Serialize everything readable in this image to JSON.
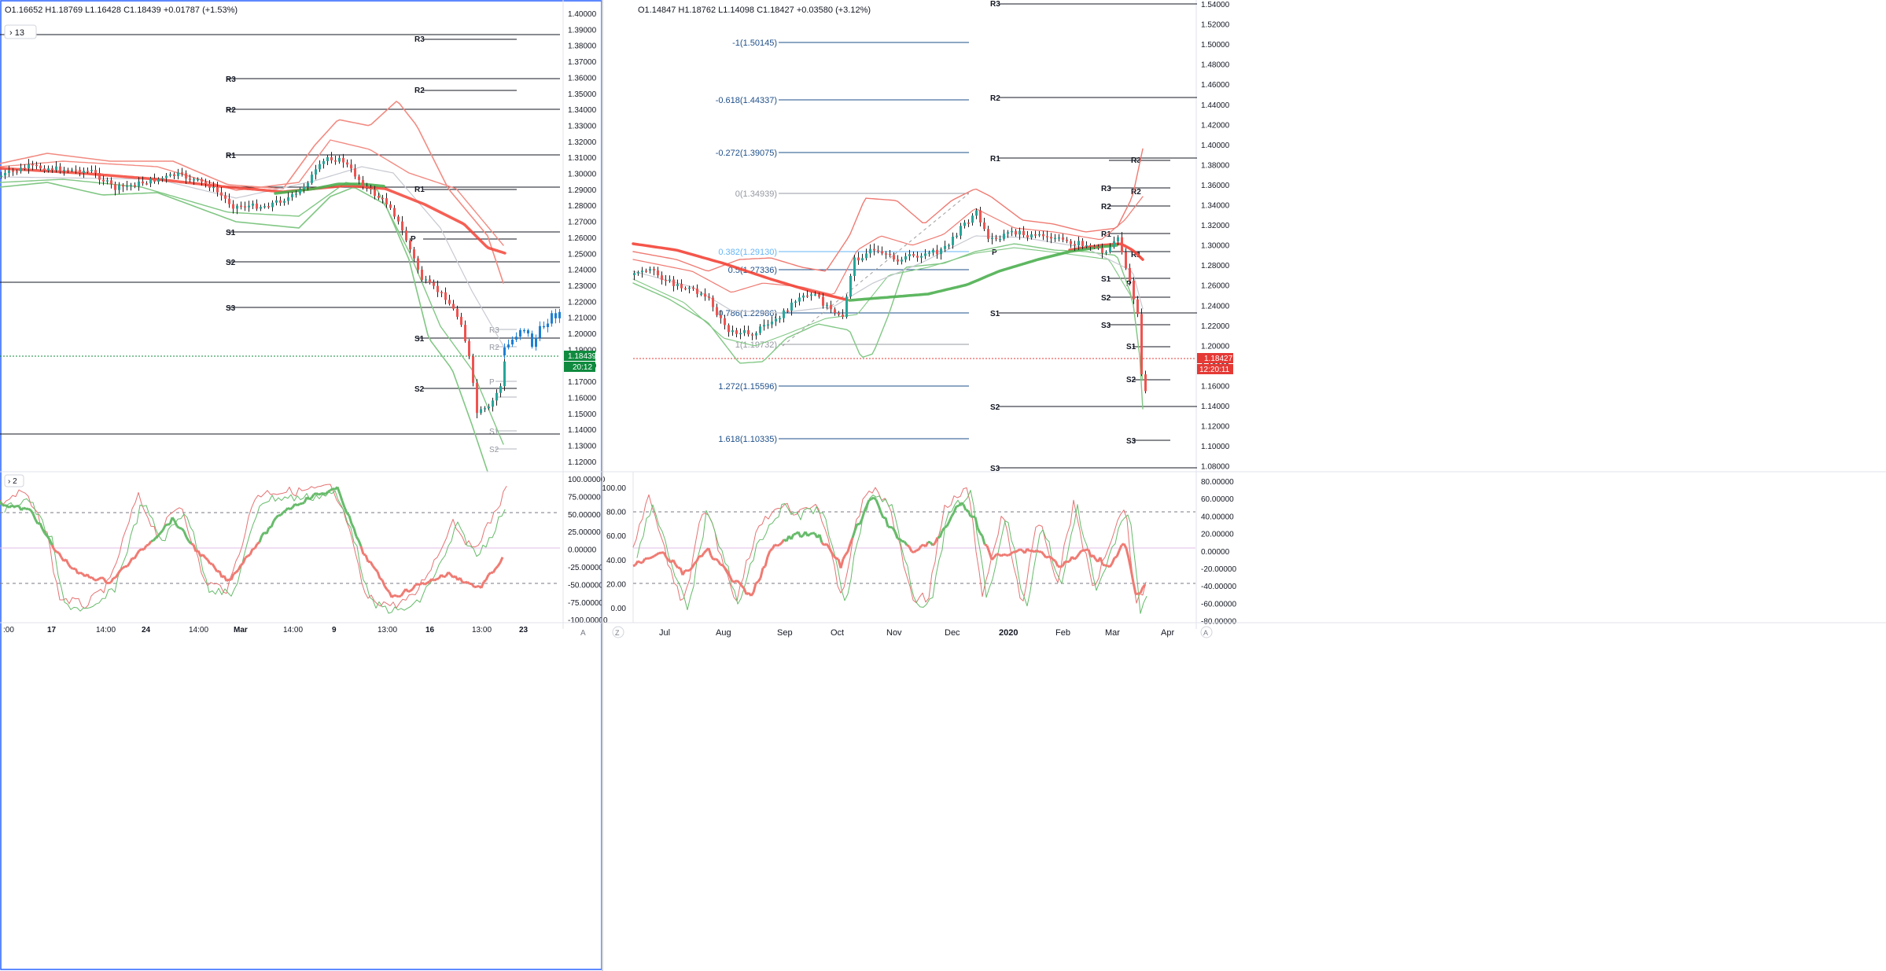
{
  "left_chart": {
    "ohlc": {
      "open": "O1.16652",
      "high": "H1.18769",
      "low": "L1.16428",
      "close": "C1.18439",
      "change": "+0.01787 (+1.53%)"
    },
    "toggle_label": "13",
    "price_axis": [
      "1.40000",
      "1.39000",
      "1.38000",
      "1.37000",
      "1.36000",
      "1.35000",
      "1.34000",
      "1.33000",
      "1.32000",
      "1.31000",
      "1.30000",
      "1.29000",
      "1.28000",
      "1.27000",
      "1.26000",
      "1.25000",
      "1.24000",
      "1.23000",
      "1.22000",
      "1.21000",
      "1.20000",
      "1.19000",
      "1.18000",
      "1.17000",
      "1.16000",
      "1.15000",
      "1.14000",
      "1.13000",
      "1.12000"
    ],
    "last_price": "1.18439",
    "countdown": "20:12",
    "pivot_labels": [
      "R3",
      "R3",
      "R2",
      "R2",
      "R1",
      "R1",
      "P",
      "S1",
      "S2",
      "S3",
      "S1",
      "S2",
      "R3",
      "R2",
      "P",
      "S1",
      "S2"
    ],
    "time_axis": [
      ":00",
      "17",
      "14:00",
      "24",
      "14:00",
      "Mar",
      "14:00",
      "9",
      "13:00",
      "16",
      "13:00",
      "23"
    ],
    "scale_button": "A"
  },
  "left_oscillator": {
    "toggle_label": "2",
    "axis": [
      "100.00000",
      "75.00000",
      "50.00000",
      "25.00000",
      "0.00000",
      "-25.00000",
      "-50.00000",
      "-75.00000",
      "-100.00000"
    ]
  },
  "right_chart": {
    "ohlc": {
      "open": "O1.14847",
      "high": "H1.18762",
      "low": "L1.14098",
      "close": "C1.18427",
      "change": "+0.03580 (+3.12%)"
    },
    "fib_levels": [
      "-1(1.50145)",
      "-0.618(1.44337)",
      "-0.272(1.39075)",
      "0(1.34939)",
      "0.382(1.29130)",
      "0.5(1.27336)",
      "0.786(1.22986)",
      "1(1.19732)",
      "1.272(1.15596)",
      "1.618(1.10335)"
    ],
    "price_axis": [
      "1.54000",
      "1.52000",
      "1.50000",
      "1.48000",
      "1.46000",
      "1.44000",
      "1.42000",
      "1.40000",
      "1.38000",
      "1.36000",
      "1.34000",
      "1.32000",
      "1.30000",
      "1.28000",
      "1.26000",
      "1.24000",
      "1.22000",
      "1.20000",
      "1.18000",
      "1.16000",
      "1.14000",
      "1.12000",
      "1.10000",
      "1.08000"
    ],
    "last_price": "1.18427",
    "countdown": "12:20:11",
    "pivot_labels": [
      "R3",
      "R2",
      "R1",
      "R3",
      "R3",
      "R2",
      "R2",
      "R1",
      "P",
      "R1",
      "S1",
      "P",
      "S2",
      "S1",
      "S3",
      "S1",
      "S2",
      "S2",
      "S3",
      "S3"
    ],
    "time_axis": [
      "Jul",
      "Aug",
      "Sep",
      "Oct",
      "Nov",
      "Dec",
      "2020",
      "Feb",
      "Mar",
      "Apr"
    ],
    "zoom_button": "Z",
    "scale_button": "A"
  },
  "right_oscillator": {
    "left_axis": [
      "100.00",
      "80.00",
      "60.00",
      "40.00",
      "20.00",
      "0.00"
    ],
    "right_axis": [
      "80.00000",
      "60.00000",
      "40.00000",
      "20.00000",
      "0.00000",
      "-20.00000",
      "-40.00000",
      "-60.00000",
      "-80.00000"
    ]
  },
  "colors": {
    "up": "#26a69a",
    "down": "#ef5350",
    "ma_red": "#f44336",
    "ma_green": "#4caf50",
    "fib": "#1e4f8a",
    "accent": "#2962ff",
    "last_green": "#0f8a3e",
    "last_red": "#e53935"
  }
}
